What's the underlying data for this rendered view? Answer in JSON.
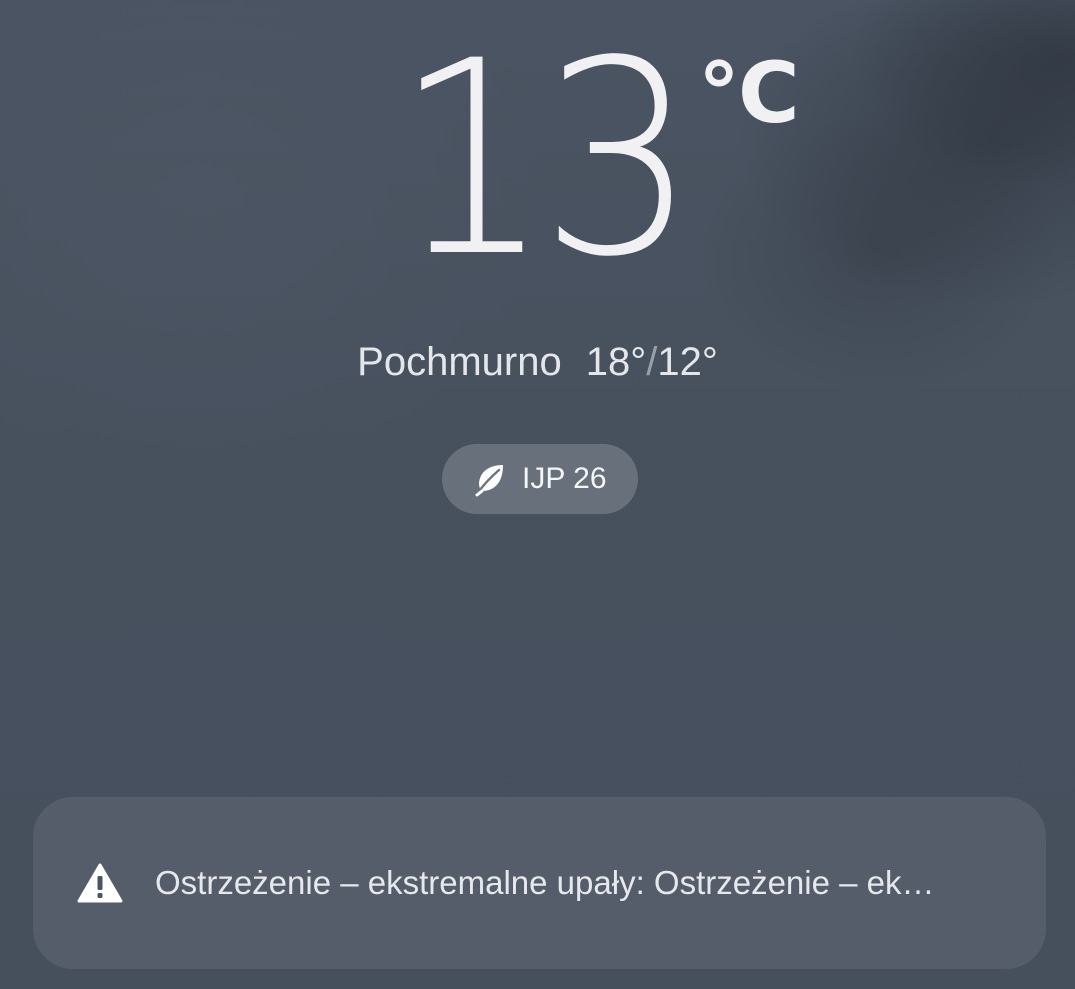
{
  "weather": {
    "temperature": "13",
    "unit": "°C",
    "condition": "Pochmurno",
    "high": "18°",
    "slash": "/",
    "low": "12°"
  },
  "air_quality": {
    "icon": "leaf-icon",
    "label": "IJP 26"
  },
  "alert": {
    "icon": "warning-icon",
    "text": "Ostrzeżenie – ekstremalne upały: Ostrzeżenie – ek…"
  }
}
